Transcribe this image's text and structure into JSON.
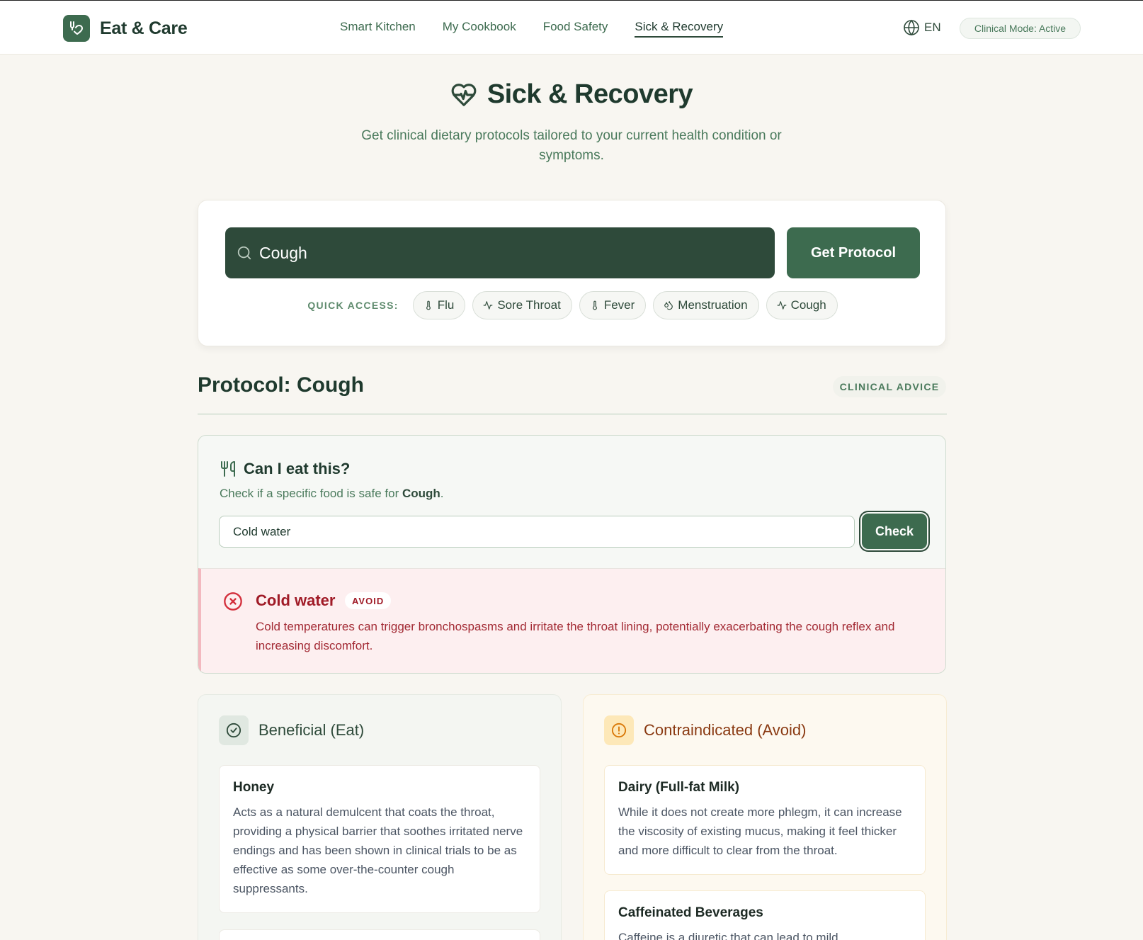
{
  "header": {
    "brand": "Eat & Care",
    "nav": [
      {
        "label": "Smart Kitchen"
      },
      {
        "label": "My Cookbook"
      },
      {
        "label": "Food Safety"
      },
      {
        "label": "Sick & Recovery",
        "active": true
      }
    ],
    "language": "EN",
    "mode_badge": "Clinical Mode: Active"
  },
  "hero": {
    "title": "Sick & Recovery",
    "subtitle": "Get clinical dietary protocols tailored to your current health condition or symptoms."
  },
  "search": {
    "value": "Cough",
    "button": "Get Protocol",
    "quick_access_label": "QUICK ACCESS:",
    "quick_access": [
      {
        "label": "Flu",
        "icon": "thermometer-icon"
      },
      {
        "label": "Sore Throat",
        "icon": "activity-icon"
      },
      {
        "label": "Fever",
        "icon": "thermometer-icon"
      },
      {
        "label": "Menstruation",
        "icon": "droplets-icon"
      },
      {
        "label": "Cough",
        "icon": "activity-icon"
      }
    ]
  },
  "protocol": {
    "title": "Protocol: Cough",
    "badge": "CLINICAL ADVICE"
  },
  "checker": {
    "title": "Can I eat this?",
    "desc_prefix": "Check if a specific food is safe for ",
    "condition": "Cough",
    "desc_suffix": ".",
    "input_value": "Cold water",
    "button": "Check",
    "result": {
      "food": "Cold water",
      "verdict": "AVOID",
      "explanation": "Cold temperatures can trigger bronchospasms and irritate the throat lining, potentially exacerbating the cough reflex and increasing discomfort."
    }
  },
  "beneficial": {
    "title": "Beneficial (Eat)",
    "items": [
      {
        "name": "Honey",
        "text": "Acts as a natural demulcent that coats the throat, providing a physical barrier that soothes irritated nerve endings and has been shown in clinical trials to be as effective as some over-the-counter cough suppressants."
      }
    ]
  },
  "contraindicated": {
    "title": "Contraindicated (Avoid)",
    "items": [
      {
        "name": "Dairy (Full-fat Milk)",
        "text": "While it does not create more phlegm, it can increase the viscosity of existing mucus, making it feel thicker and more difficult to clear from the throat."
      },
      {
        "name": "Caffeinated Beverages",
        "text": "Caffeine is a diuretic that can lead to mild"
      }
    ]
  },
  "colors": {
    "primary": "#3d6b4f",
    "dark": "#2e4a3a",
    "background": "#f8f6f1",
    "avoid_red": "#a01b27",
    "warning_amber": "#d97706"
  }
}
